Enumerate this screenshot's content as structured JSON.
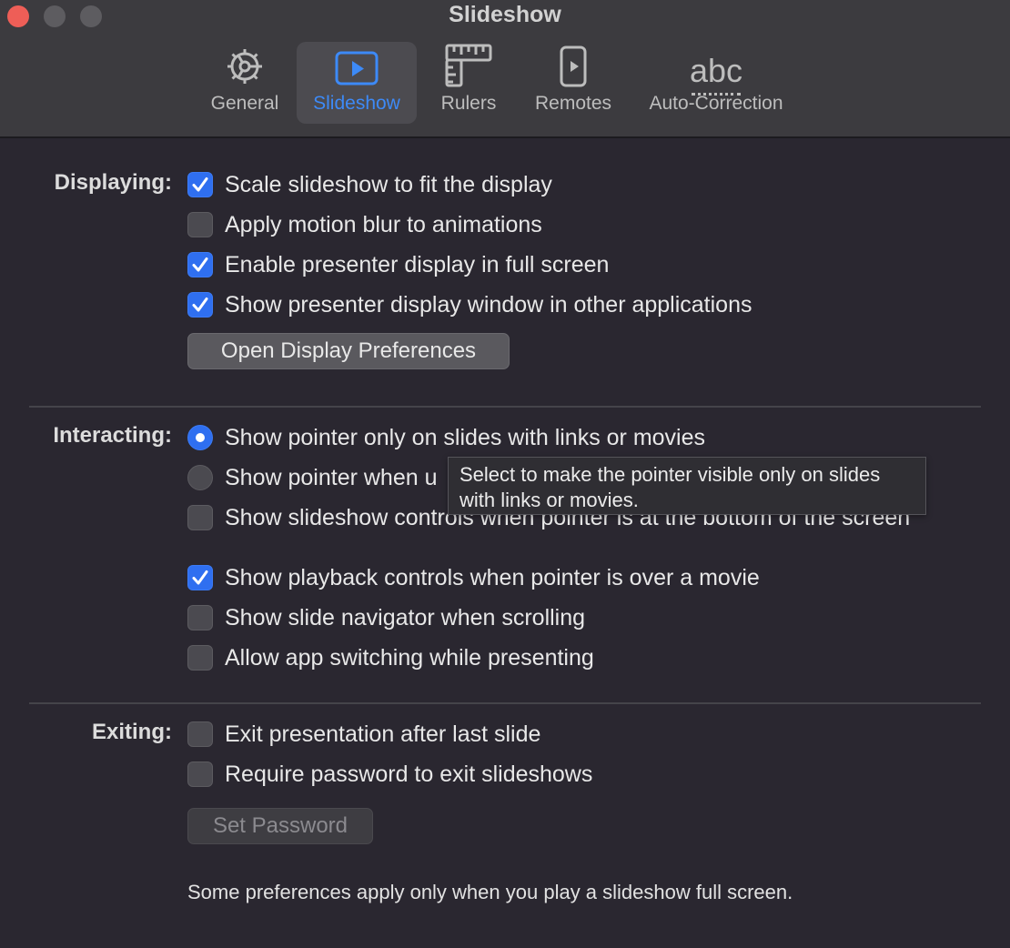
{
  "window": {
    "title": "Slideshow"
  },
  "tabs": {
    "general": "General",
    "slideshow": "Slideshow",
    "rulers": "Rulers",
    "remotes": "Remotes",
    "autocorrect": "Auto-Correction",
    "autocorrect_icon_text": "abc",
    "active": "Slideshow"
  },
  "displaying": {
    "label": "Displaying:",
    "options": [
      {
        "label": "Scale slideshow to fit the display",
        "checked": true
      },
      {
        "label": "Apply motion blur to animations",
        "checked": false
      },
      {
        "label": "Enable presenter display in full screen",
        "checked": true
      },
      {
        "label": "Show presenter display window in other applications",
        "checked": true
      }
    ],
    "button": "Open Display Preferences"
  },
  "interacting": {
    "label": "Interacting:",
    "pointer_options": [
      {
        "label": "Show pointer only on slides with links or movies",
        "selected": true
      },
      {
        "label": "Show pointer when u",
        "selected": false
      }
    ],
    "options": [
      {
        "label": "Show slideshow controls when pointer is at the bottom of the screen",
        "checked": false
      },
      {
        "label": "Show playback controls when pointer is over a movie",
        "checked": true
      },
      {
        "label": "Show slide navigator when scrolling",
        "checked": false
      },
      {
        "label": "Allow app switching while presenting",
        "checked": false
      }
    ],
    "tooltip": "Select to make the pointer visible only on slides with links or movies."
  },
  "exiting": {
    "label": "Exiting:",
    "options": [
      {
        "label": "Exit presentation after last slide",
        "checked": false
      },
      {
        "label": "Require password to exit slideshows",
        "checked": false
      }
    ],
    "button": "Set Password",
    "button_enabled": false
  },
  "footnote": "Some preferences apply only when you play a slideshow full screen.",
  "colors": {
    "accent": "#2f6ff0",
    "close": "#ee5e57",
    "active_tab_text": "#3d8af7"
  }
}
